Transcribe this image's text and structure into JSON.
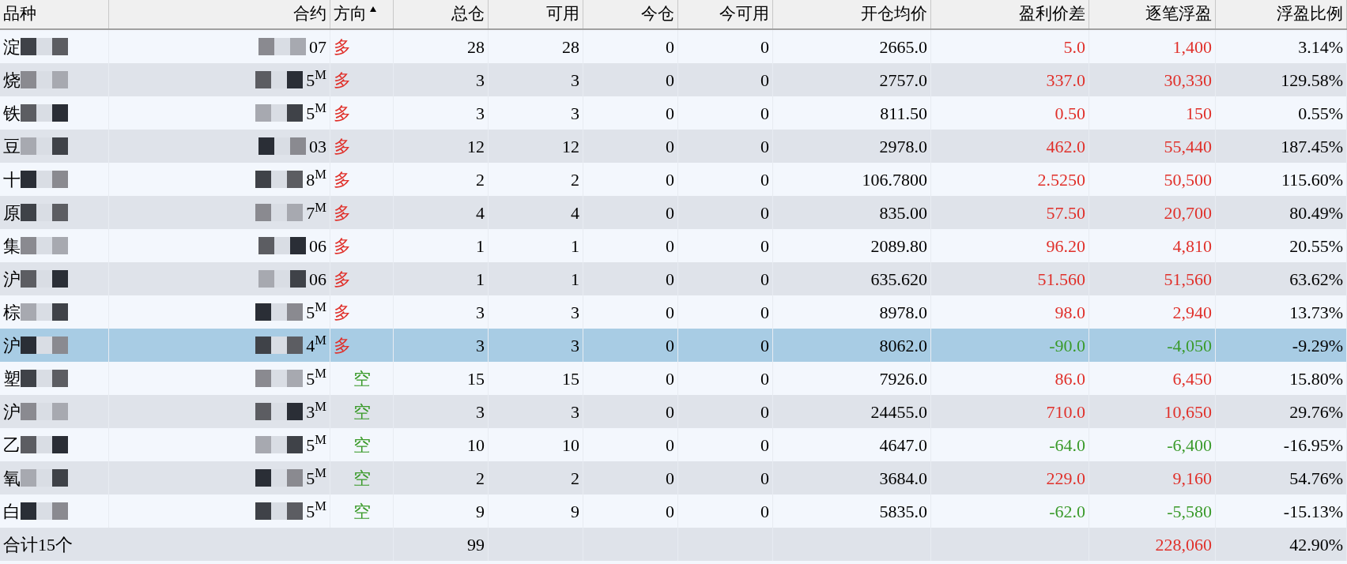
{
  "columns": [
    {
      "label": "品种",
      "sorted": false
    },
    {
      "label": "合约",
      "sorted": false
    },
    {
      "label": "方向",
      "sorted": true
    },
    {
      "label": "总仓",
      "sorted": false
    },
    {
      "label": "可用",
      "sorted": false
    },
    {
      "label": "今仓",
      "sorted": false
    },
    {
      "label": "今可用",
      "sorted": false
    },
    {
      "label": "开仓均价",
      "sorted": false
    },
    {
      "label": "盈利价差",
      "sorted": false
    },
    {
      "label": "逐笔浮盈",
      "sorted": false
    },
    {
      "label": "浮盈比例",
      "sorted": false
    }
  ],
  "rows": [
    {
      "variety": "淀",
      "contract": "07",
      "direction": {
        "label": "多",
        "kind": "long"
      },
      "total": "28",
      "available": "28",
      "today": "0",
      "today_available": "0",
      "open_avg": "2665.0",
      "price_diff": "5.0",
      "float_pl": "1,400",
      "float_ratio": "3.14%",
      "loss": false,
      "selected": false
    },
    {
      "variety": "烧",
      "contract": "5$^{M}$",
      "direction": {
        "label": "多",
        "kind": "long"
      },
      "total": "3",
      "available": "3",
      "today": "0",
      "today_available": "0",
      "open_avg": "2757.0",
      "price_diff": "337.0",
      "float_pl": "30,330",
      "float_ratio": "129.58%",
      "loss": false,
      "selected": false
    },
    {
      "variety": "铁",
      "contract": "5$^{M}$",
      "direction": {
        "label": "多",
        "kind": "long"
      },
      "total": "3",
      "available": "3",
      "today": "0",
      "today_available": "0",
      "open_avg": "811.50",
      "price_diff": "0.50",
      "float_pl": "150",
      "float_ratio": "0.55%",
      "loss": false,
      "selected": false
    },
    {
      "variety": "豆",
      "contract": "03",
      "direction": {
        "label": "多",
        "kind": "long"
      },
      "total": "12",
      "available": "12",
      "today": "0",
      "today_available": "0",
      "open_avg": "2978.0",
      "price_diff": "462.0",
      "float_pl": "55,440",
      "float_ratio": "187.45%",
      "loss": false,
      "selected": false
    },
    {
      "variety": "十",
      "contract": "8$^{M}$",
      "direction": {
        "label": "多",
        "kind": "long"
      },
      "total": "2",
      "available": "2",
      "today": "0",
      "today_available": "0",
      "open_avg": "106.7800",
      "price_diff": "2.5250",
      "float_pl": "50,500",
      "float_ratio": "115.60%",
      "loss": false,
      "selected": false
    },
    {
      "variety": "原",
      "contract": "7$^{M}$",
      "direction": {
        "label": "多",
        "kind": "long"
      },
      "total": "4",
      "available": "4",
      "today": "0",
      "today_available": "0",
      "open_avg": "835.00",
      "price_diff": "57.50",
      "float_pl": "20,700",
      "float_ratio": "80.49%",
      "loss": false,
      "selected": false
    },
    {
      "variety": "集",
      "contract": "06",
      "direction": {
        "label": "多",
        "kind": "long"
      },
      "total": "1",
      "available": "1",
      "today": "0",
      "today_available": "0",
      "open_avg": "2089.80",
      "price_diff": "96.20",
      "float_pl": "4,810",
      "float_ratio": "20.55%",
      "loss": false,
      "selected": false
    },
    {
      "variety": "沪",
      "contract": "06",
      "direction": {
        "label": "多",
        "kind": "long"
      },
      "total": "1",
      "available": "1",
      "today": "0",
      "today_available": "0",
      "open_avg": "635.620",
      "price_diff": "51.560",
      "float_pl": "51,560",
      "float_ratio": "63.62%",
      "loss": false,
      "selected": false
    },
    {
      "variety": "棕",
      "contract": "5$^{M}$",
      "direction": {
        "label": "多",
        "kind": "long"
      },
      "total": "3",
      "available": "3",
      "today": "0",
      "today_available": "0",
      "open_avg": "8978.0",
      "price_diff": "98.0",
      "float_pl": "2,940",
      "float_ratio": "13.73%",
      "loss": false,
      "selected": false
    },
    {
      "variety": "沪",
      "contract": "4$^{M}$",
      "direction": {
        "label": "多",
        "kind": "long"
      },
      "total": "3",
      "available": "3",
      "today": "0",
      "today_available": "0",
      "open_avg": "8062.0",
      "price_diff": "-90.0",
      "float_pl": "-4,050",
      "float_ratio": "-9.29%",
      "loss": true,
      "selected": true
    },
    {
      "variety": "塑",
      "contract": "5$^{M}$",
      "direction": {
        "label": "空",
        "kind": "short"
      },
      "total": "15",
      "available": "15",
      "today": "0",
      "today_available": "0",
      "open_avg": "7926.0",
      "price_diff": "86.0",
      "float_pl": "6,450",
      "float_ratio": "15.80%",
      "loss": false,
      "selected": false
    },
    {
      "variety": "沪",
      "contract": "3$^{M}$",
      "direction": {
        "label": "空",
        "kind": "short"
      },
      "total": "3",
      "available": "3",
      "today": "0",
      "today_available": "0",
      "open_avg": "24455.0",
      "price_diff": "710.0",
      "float_pl": "10,650",
      "float_ratio": "29.76%",
      "loss": false,
      "selected": false
    },
    {
      "variety": "乙",
      "contract": "5$^{M}$",
      "direction": {
        "label": "空",
        "kind": "short"
      },
      "total": "10",
      "available": "10",
      "today": "0",
      "today_available": "0",
      "open_avg": "4647.0",
      "price_diff": "-64.0",
      "float_pl": "-6,400",
      "float_ratio": "-16.95%",
      "loss": true,
      "selected": false
    },
    {
      "variety": "氧",
      "contract": "5$^{M}$",
      "direction": {
        "label": "空",
        "kind": "short"
      },
      "total": "2",
      "available": "2",
      "today": "0",
      "today_available": "0",
      "open_avg": "3684.0",
      "price_diff": "229.0",
      "float_pl": "9,160",
      "float_ratio": "54.76%",
      "loss": false,
      "selected": false
    },
    {
      "variety": "白",
      "contract": "5$^{M}$",
      "direction": {
        "label": "空",
        "kind": "short"
      },
      "total": "9",
      "available": "9",
      "today": "0",
      "today_available": "0",
      "open_avg": "5835.0",
      "price_diff": "-62.0",
      "float_pl": "-5,580",
      "float_ratio": "-15.13%",
      "loss": true,
      "selected": false
    }
  ],
  "summary": {
    "label": "合计15个",
    "total": "99",
    "float_pl": "228,060",
    "float_ratio": "42.90%",
    "loss": false
  }
}
